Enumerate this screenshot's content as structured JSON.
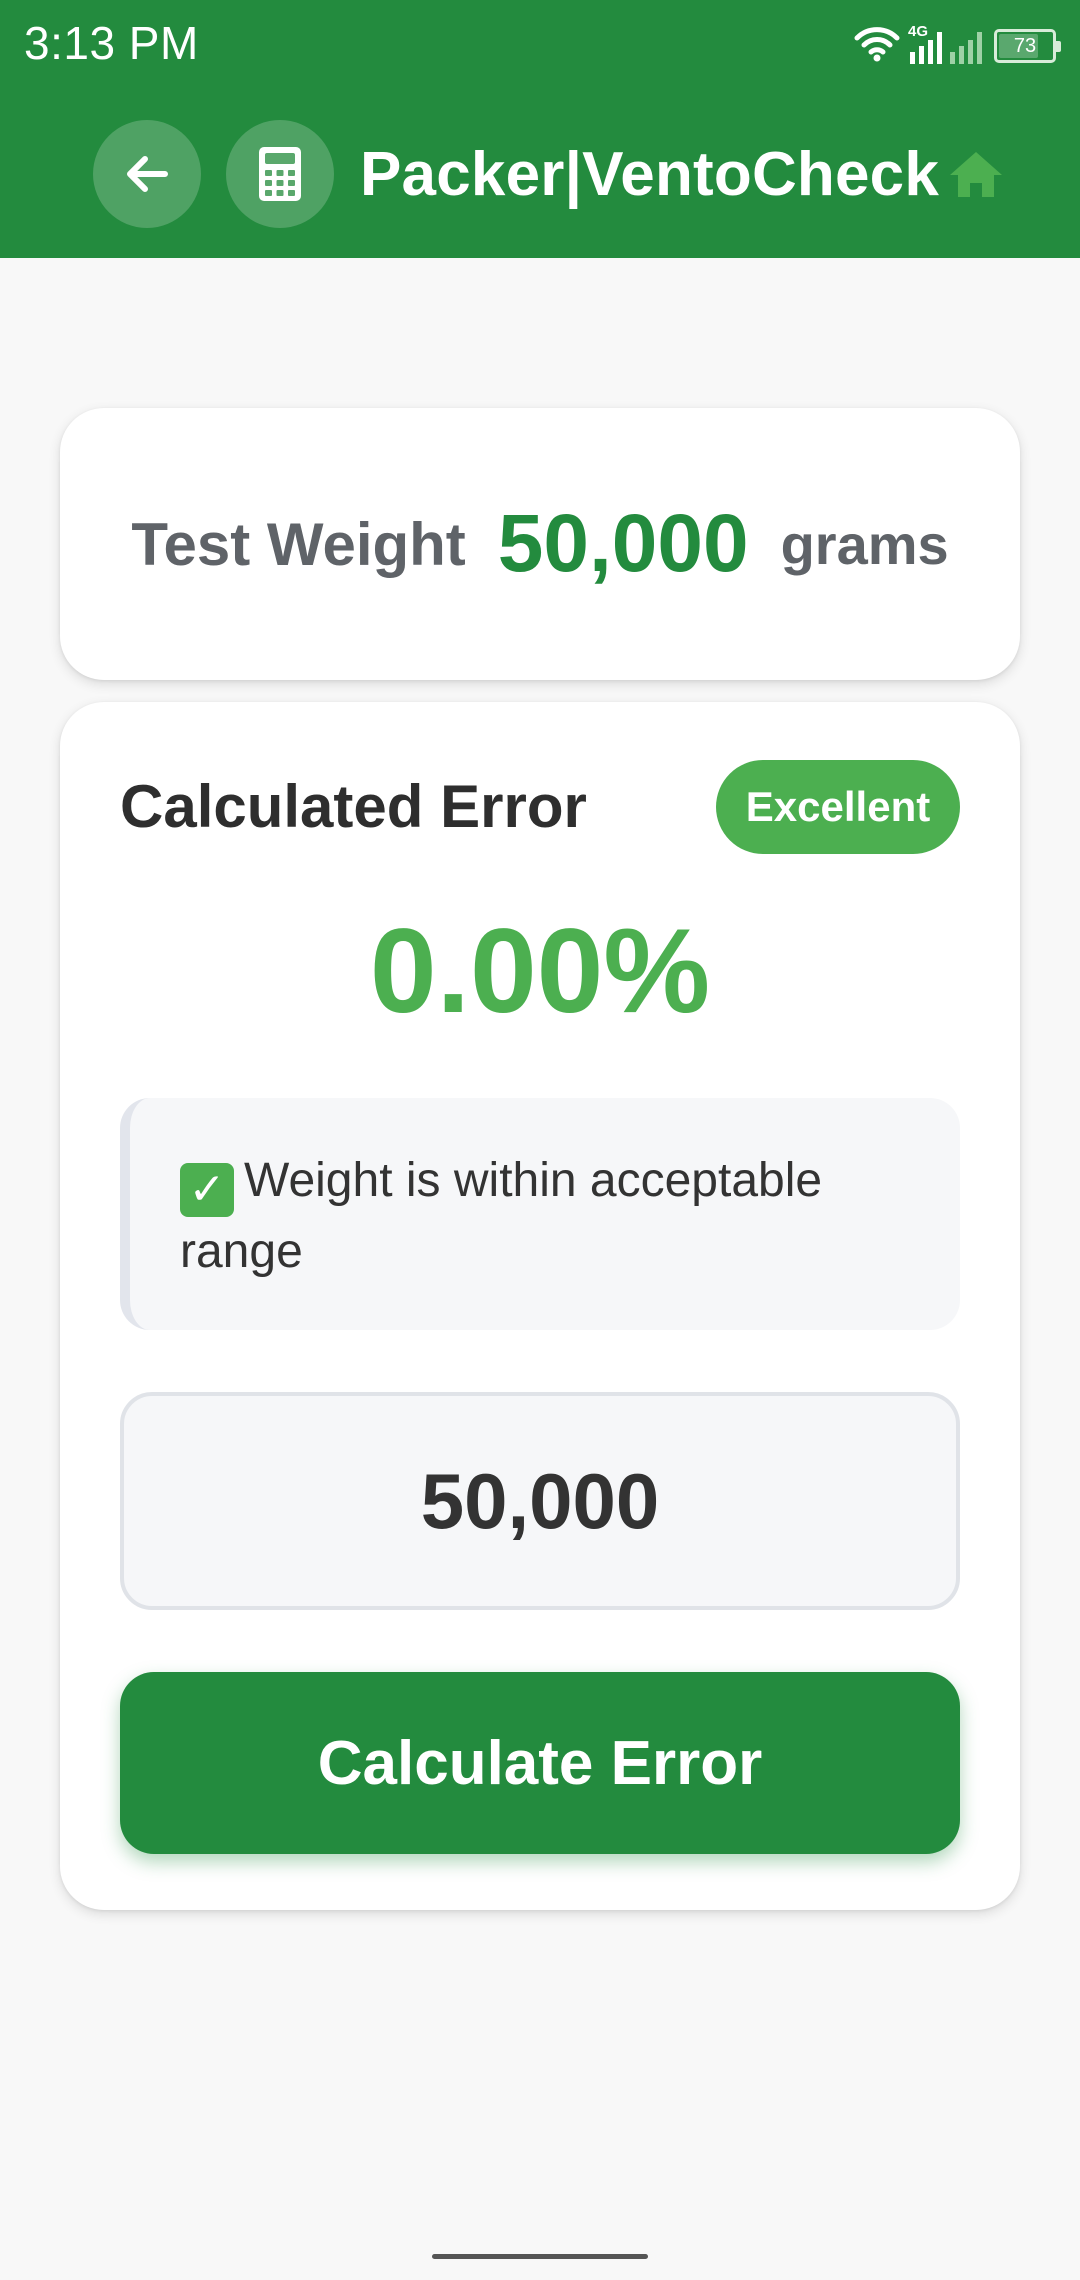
{
  "status_bar": {
    "time": "3:13 PM",
    "network": "4G",
    "battery": "73",
    "icons": [
      "wifi-icon",
      "signal-icon",
      "battery-icon"
    ]
  },
  "header": {
    "title": "Packer|VentoCheck",
    "back_icon": "arrow-left-icon",
    "app_icon": "calculator-icon",
    "home_icon": "home-icon"
  },
  "test_weight": {
    "label": "Test Weight",
    "value": "50,000",
    "unit": "grams"
  },
  "result": {
    "heading": "Calculated Error",
    "badge": "Excellent",
    "error_value": "0.00%",
    "status_message": "Weight is within acceptable range",
    "status_icon": "check-mark-icon"
  },
  "input": {
    "value": "50,000"
  },
  "actions": {
    "calculate_label": "Calculate Error"
  },
  "colors": {
    "primary": "#238b3e",
    "success": "#4caf50",
    "background": "#f8f8f8"
  }
}
